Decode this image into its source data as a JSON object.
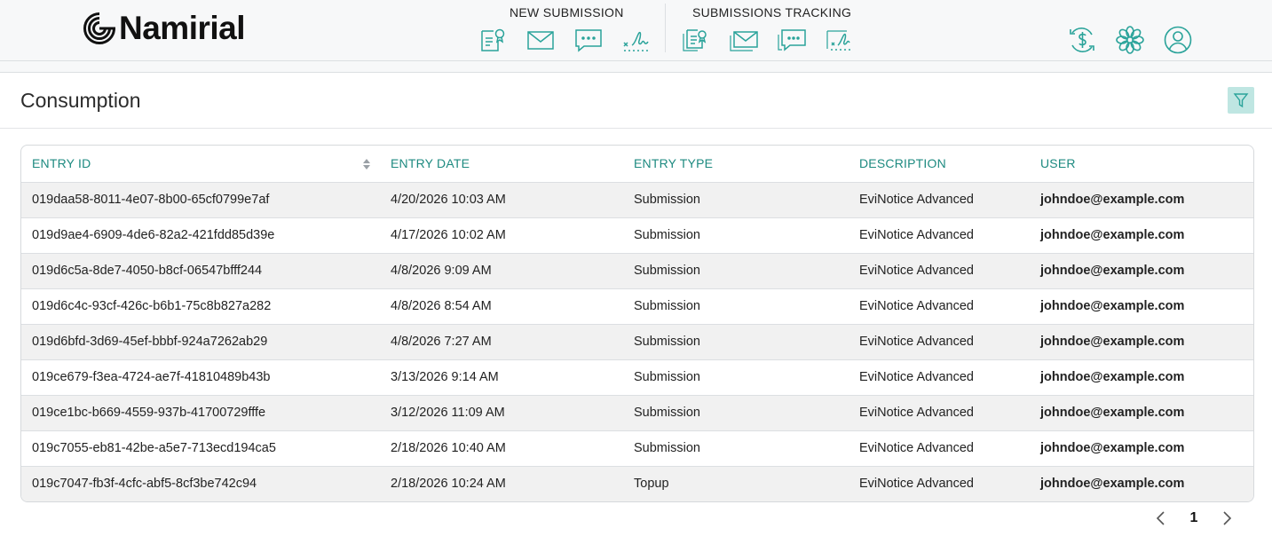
{
  "brand": {
    "name": "Namirial",
    "logo_icon": "namirial-logo-icon"
  },
  "nav": {
    "new_submission": {
      "title": "NEW SUBMISSION",
      "icons": [
        "form-icon",
        "mail-icon",
        "sms-chat-icon",
        "signature-icon"
      ]
    },
    "submissions_tracking": {
      "title": "SUBMISSIONS TRACKING",
      "icons": [
        "form-tracking-icon",
        "mail-tracking-icon",
        "sms-tracking-icon",
        "signature-tracking-icon"
      ]
    },
    "right_icons": [
      "billing-dollar-icon",
      "settings-flower-icon",
      "user-account-icon"
    ]
  },
  "page": {
    "title": "Consumption",
    "filter_icon": "filter-icon"
  },
  "table": {
    "columns": [
      "ENTRY ID",
      "ENTRY DATE",
      "ENTRY TYPE",
      "DESCRIPTION",
      "USER"
    ],
    "rows": [
      [
        "019daa58-8011-4e07-8b00-65cf0799e7af",
        "4/20/2026 10:03 AM",
        "Submission",
        "EviNotice Advanced",
        "johndoe@example.com"
      ],
      [
        "019d9ae4-6909-4de6-82a2-421fdd85d39e",
        "4/17/2026 10:02 AM",
        "Submission",
        "EviNotice Advanced",
        "johndoe@example.com"
      ],
      [
        "019d6c5a-8de7-4050-b8cf-06547bfff244",
        "4/8/2026 9:09 AM",
        "Submission",
        "EviNotice Advanced",
        "johndoe@example.com"
      ],
      [
        "019d6c4c-93cf-426c-b6b1-75c8b827a282",
        "4/8/2026 8:54 AM",
        "Submission",
        "EviNotice Advanced",
        "johndoe@example.com"
      ],
      [
        "019d6bfd-3d69-45ef-bbbf-924a7262ab29",
        "4/8/2026 7:27 AM",
        "Submission",
        "EviNotice Advanced",
        "johndoe@example.com"
      ],
      [
        "019ce679-f3ea-4724-ae7f-41810489b43b",
        "3/13/2026 9:14 AM",
        "Submission",
        "EviNotice Advanced",
        "johndoe@example.com"
      ],
      [
        "019ce1bc-b669-4559-937b-41700729fffe",
        "3/12/2026 11:09 AM",
        "Submission",
        "EviNotice Advanced",
        "johndoe@example.com"
      ],
      [
        "019c7055-eb81-42be-a5e7-713ecd194ca5",
        "2/18/2026 10:40 AM",
        "Submission",
        "EviNotice Advanced",
        "johndoe@example.com"
      ],
      [
        "019c7047-fb3f-4cfc-abf5-8cf3be742c94",
        "2/18/2026 10:24 AM",
        "Topup",
        "EviNotice Advanced",
        "johndoe@example.com"
      ]
    ]
  },
  "pagination": {
    "current_page": "1",
    "prev_icon": "chevron-left-icon",
    "next_icon": "chevron-right-icon"
  },
  "colors": {
    "accent": "#1d8a80",
    "accent_light": "#bfe6e2",
    "row_stripe": "#f1f1f1",
    "header_bg": "#f7f8f9"
  }
}
